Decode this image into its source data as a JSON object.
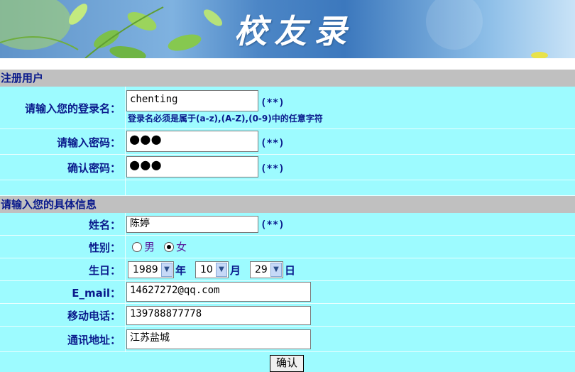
{
  "banner": {
    "title": "校友录"
  },
  "register": {
    "section_title": "注册用户",
    "username": {
      "label": "请输入您的登录名：",
      "value": "chenting",
      "required": "(**)",
      "hint": "登录名必须是属于(a-z),(A-Z),(0-9)中的任意字符"
    },
    "password": {
      "label": "请输入密码：",
      "value": "●●●",
      "required": "(**)"
    },
    "confirm": {
      "label": "确认密码：",
      "value": "●●●",
      "required": "(**)"
    }
  },
  "details": {
    "section_title": "请输入您的具体信息",
    "name": {
      "label": "姓名：",
      "value": "陈婷",
      "required": "(**)"
    },
    "gender": {
      "label": "性别：",
      "options": [
        "男",
        "女"
      ],
      "selected": "女"
    },
    "birthday": {
      "label": "生日：",
      "year": "1989",
      "year_unit": "年",
      "month": "10",
      "month_unit": "月",
      "day": "29",
      "day_unit": "日"
    },
    "email": {
      "label": "E_mail：",
      "value": "14627272@qq.com"
    },
    "mobile": {
      "label": "移动电话：",
      "value": "139788877778"
    },
    "address": {
      "label": "通讯地址：",
      "value": "江苏盐城"
    }
  },
  "submit_label": "确认"
}
